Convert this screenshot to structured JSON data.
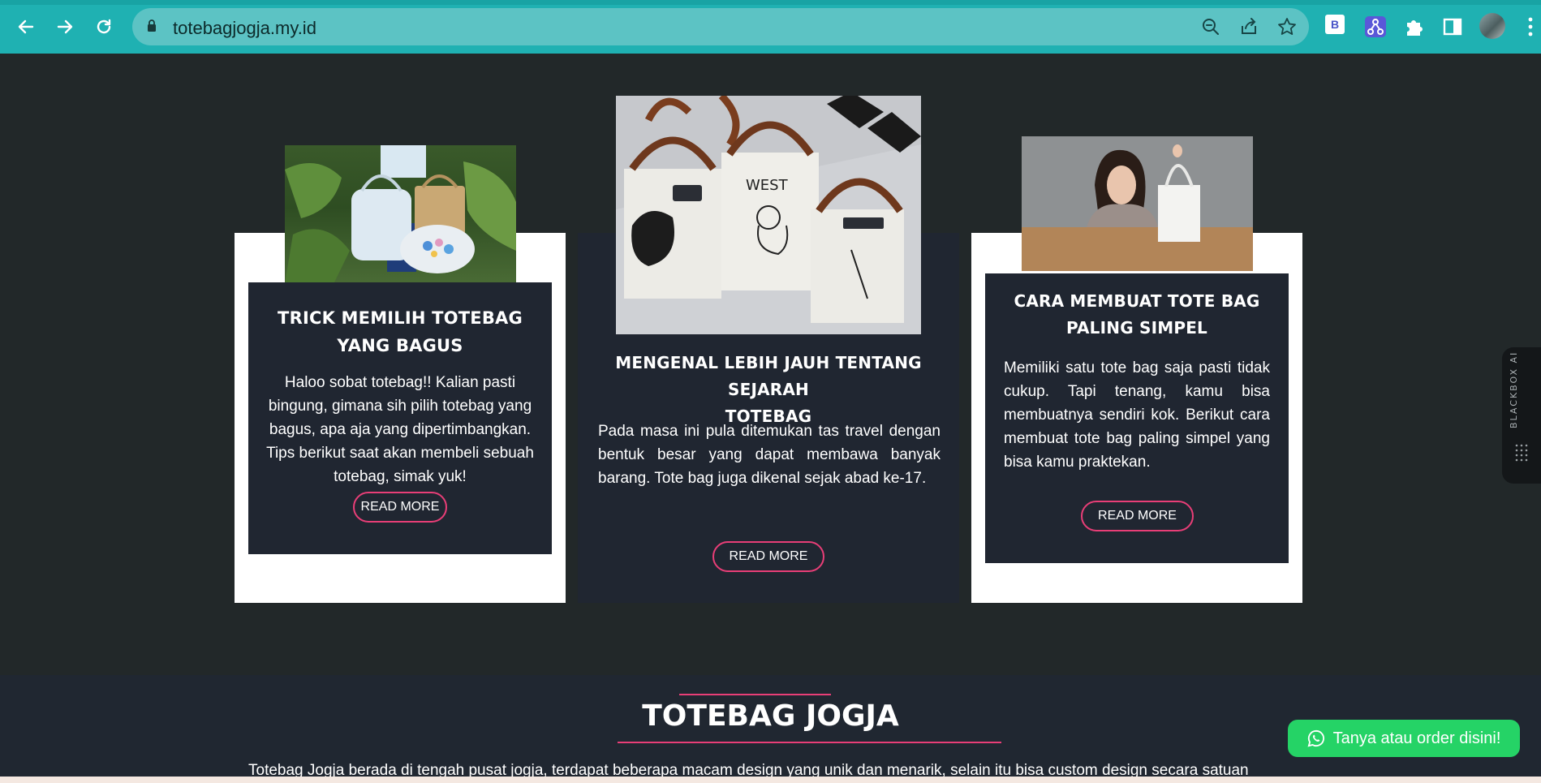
{
  "browser": {
    "url": "totebagjogja.my.id",
    "extensions": [
      "bootstrap-icon",
      "fork-icon",
      "puzzle-icon",
      "sidebar-icon"
    ]
  },
  "cards": [
    {
      "title_line1": "TRICK MEMILIH TOTEBAG",
      "title_line2": "YANG BAGUS",
      "text": "Haloo sobat totebag!!  Kalian pasti bingung, gimana sih pilih totebag yang bagus, apa aja yang dipertimbangkan. Tips berikut saat akan membeli sebuah totebag, simak yuk!",
      "button": "READ MORE"
    },
    {
      "title_line1": "MENGENAL LEBIH JAUH TENTANG SEJARAH",
      "title_line2": "TOTEBAG",
      "text": "Pada masa ini pula ditemukan tas travel dengan bentuk besar yang dapat membawa banyak barang. Tote bag juga dikenal sejak abad ke-17.",
      "button": "READ MORE",
      "photo_text": "WEST"
    },
    {
      "title_line1": "CARA MEMBUAT TOTE BAG",
      "title_line2": "PALING SIMPEL",
      "text": "Memiliki satu tote bag saja pasti tidak cukup. Tapi tenang, kamu bisa membuatnya sendiri kok. Berikut cara membuat tote bag paling simpel yang bisa kamu praktekan.",
      "button": "READ MORE"
    }
  ],
  "section": {
    "title": "TOTEBAG JOGJA",
    "subtitle": "Totebag Jogja berada di tengah pusat jogja, terdapat beberapa macam design yang unik dan menarik, selain itu bisa custom design secara satuan"
  },
  "whatsapp": {
    "label": "Tanya atau order disini!"
  },
  "blackbox": {
    "label": "BLACKBOX AI"
  },
  "colors": {
    "accent": "#e83e77",
    "chrome": "#1fb1b2",
    "whatsapp": "#25d366",
    "card_dark": "#202631"
  }
}
